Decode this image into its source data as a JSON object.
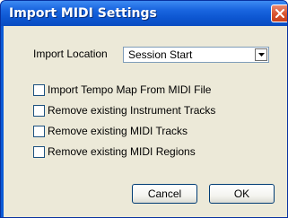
{
  "dialog": {
    "title": "Import MIDI Settings",
    "import_location": {
      "label": "Import Location",
      "selected": "Session Start"
    },
    "options": [
      {
        "label": "Import Tempo Map From MIDI File",
        "checked": false
      },
      {
        "label": "Remove existing Instrument Tracks",
        "checked": false
      },
      {
        "label": "Remove existing MIDI Tracks",
        "checked": false
      },
      {
        "label": "Remove existing MIDI Regions",
        "checked": false
      }
    ],
    "buttons": {
      "cancel": "Cancel",
      "ok": "OK"
    }
  },
  "colors": {
    "titlebar": "#0c55d0",
    "client_bg": "#ece9d8",
    "close_button": "#d8542f"
  },
  "icons": {
    "close": "close-icon",
    "dropdown": "chevron-down-icon"
  }
}
